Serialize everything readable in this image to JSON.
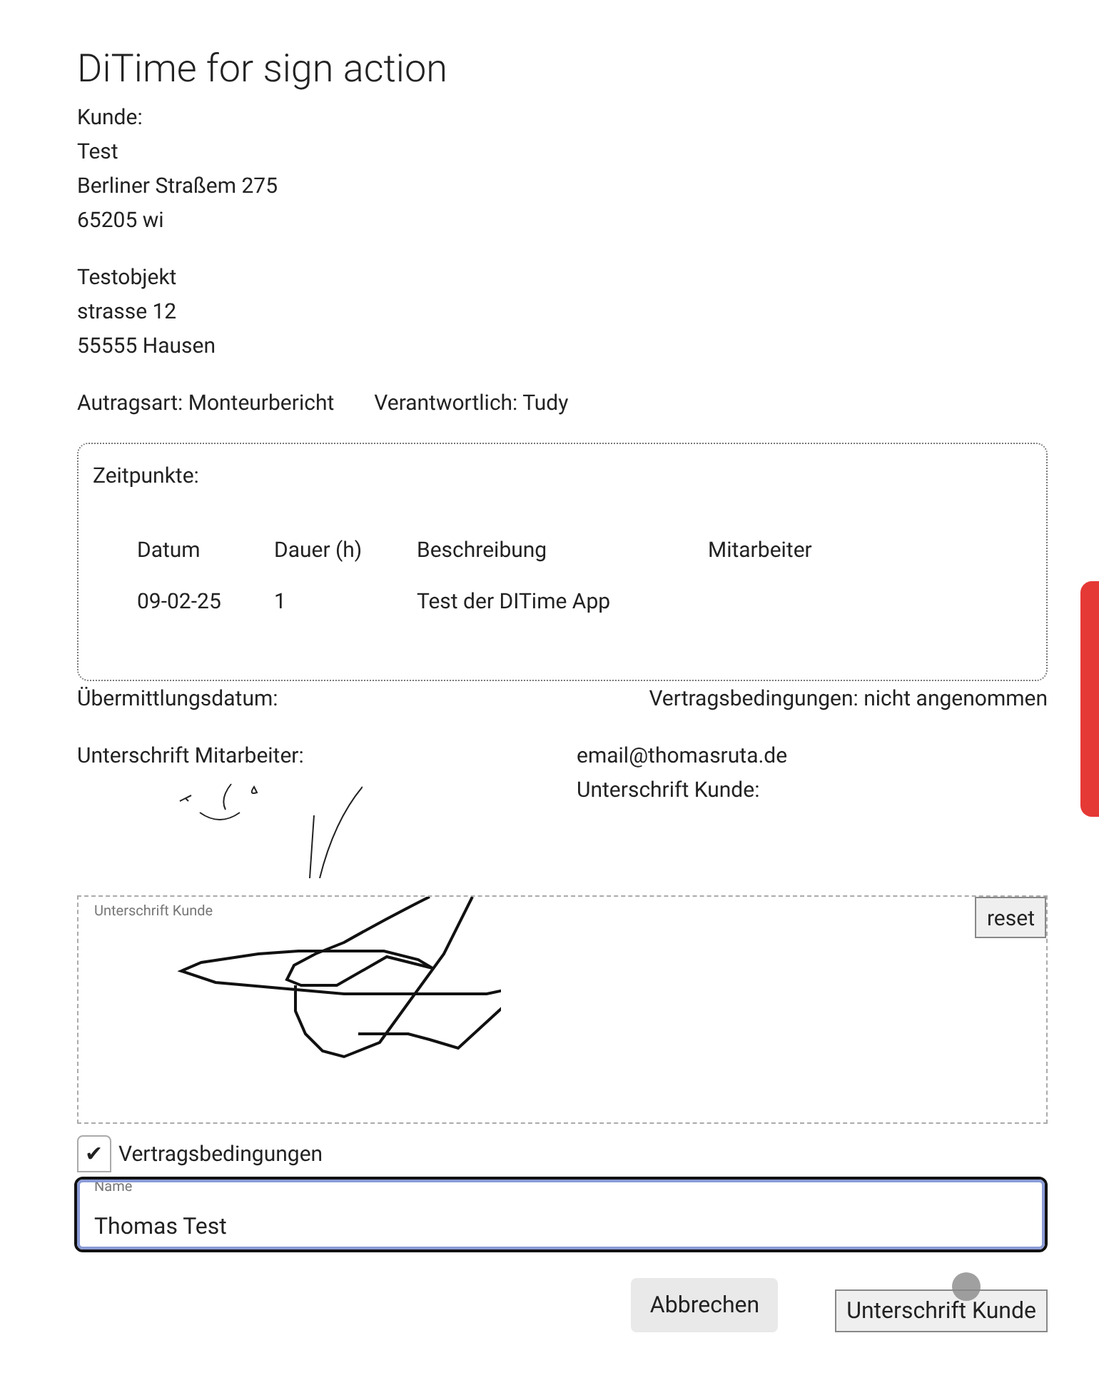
{
  "title": "DiTime for sign action",
  "customer": {
    "label": "Kunde:",
    "lines": [
      "Test",
      "Berliner Straßem 275",
      "65205 wi"
    ]
  },
  "object": {
    "lines": [
      "Testobjekt",
      "strasse 12",
      "55555 Hausen"
    ]
  },
  "order_type": "Autragsart: Monteurbericht",
  "responsible": "Verantwortlich: Tudy",
  "times": {
    "label": "Zeitpunkte:",
    "columns": [
      "Datum",
      "Dauer (h)",
      "Beschreibung",
      "Mitarbeiter"
    ],
    "rows": [
      [
        "09-02-25",
        "1",
        "Test der DITime App",
        ""
      ]
    ]
  },
  "transmission_date": "Übermittlungsdatum:",
  "terms_status": "Vertragsbedingungen: nicht angenommen",
  "employee_signature_label": "Unterschrift Mitarbeiter:",
  "email": "email@thomasruta.de",
  "customer_signature_label": "Unterschrift Kunde:",
  "signature_pad": {
    "label": "Unterschrift Kunde",
    "reset": "reset"
  },
  "terms_checkbox": {
    "label": "Vertragsbedingungen",
    "checked": true,
    "mark": "✔"
  },
  "name_field": {
    "label": "Name",
    "value": "Thomas Test"
  },
  "buttons": {
    "cancel": "Abbrechen",
    "submit": "Unterschrift Kunde"
  }
}
